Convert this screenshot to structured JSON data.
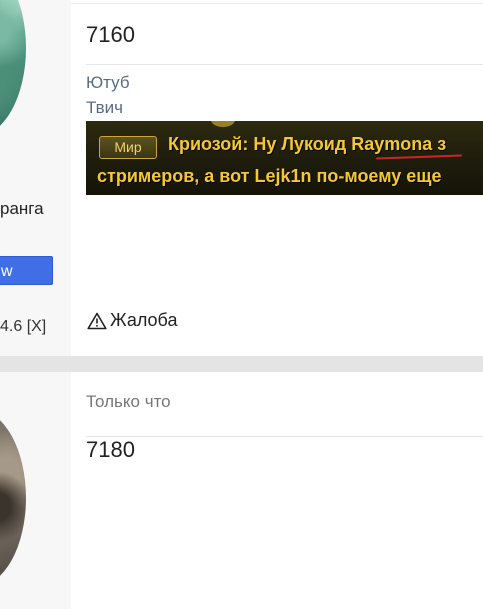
{
  "posts": [
    {
      "author_rank": "ранга",
      "follow_label": "w",
      "version_text": "4.6 [X]",
      "number": "7160",
      "links": [
        "Ютуб",
        "Твич"
      ],
      "image_text": {
        "badge": "Мир",
        "line1": "Криозой: Ну Лукоид Raymona з",
        "line2": "стримеров, а вот Lejk1n по-моему еще"
      },
      "report_label": "Жалоба"
    },
    {
      "timestamp": "Только что",
      "number": "7180"
    }
  ],
  "colors": {
    "page_background": "#e4e4e4",
    "sidebar_background": "#f7f7f7",
    "follow_button": "#3f6ee6",
    "link": "#5a6b86",
    "game_text": "#f4c834"
  },
  "icons": {
    "report": "warning-triangle-icon"
  }
}
